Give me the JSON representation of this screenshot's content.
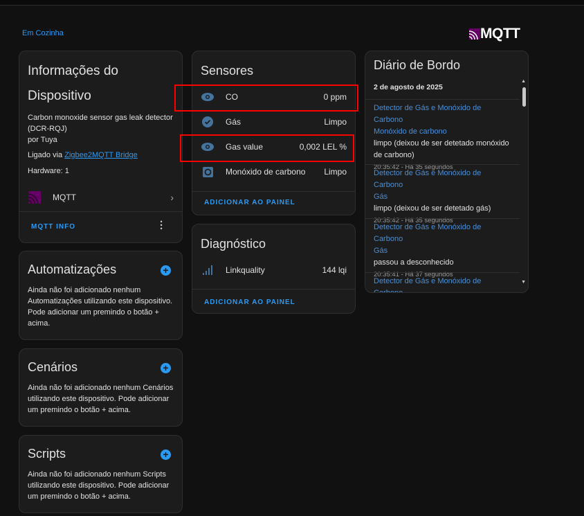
{
  "breadcrumb": "Em Cozinha",
  "logo": "MQTT",
  "device_info": {
    "title_line1": "Informações do",
    "title_line2": "Dispositivo",
    "model": "Carbon monoxide sensor gas leak detector",
    "model_id": "(DCR-RQJ)",
    "manufacturer": "por Tuya",
    "connected_prefix": "Ligado via ",
    "connected_link": "Zigbee2MQTT Bridge",
    "hardware": "Hardware: 1",
    "integration": "MQTT",
    "action": "MQTT INFO"
  },
  "automations": {
    "title": "Automatizações",
    "text": "Ainda não foi adicionado nenhum Automatizações utilizando este dispositivo. Pode adicionar um premindo o botão + acima."
  },
  "scenes": {
    "title": "Cenários",
    "text": "Ainda não foi adicionado nenhum Cenários utilizando este dispositivo. Pode adicionar um premindo o botão + acima."
  },
  "scripts": {
    "title": "Scripts",
    "text": "Ainda não foi adicionado nenhum Scripts utilizando este dispositivo. Pode adicionar um premindo o botão + acima."
  },
  "sensors": {
    "title": "Sensores",
    "items": [
      {
        "name": "CO",
        "value": "0 ppm",
        "icon": "eye-icon"
      },
      {
        "name": "Gás",
        "value": "Limpo",
        "icon": "check-circle-icon"
      },
      {
        "name": "Gas value",
        "value": "0,002 LEL %",
        "icon": "eye-icon"
      },
      {
        "name": "Monóxido de carbono",
        "value": "Limpo",
        "icon": "smoke-detector-icon"
      }
    ],
    "action": "ADICIONAR AO PAINEL"
  },
  "diagnostics": {
    "title": "Diagnóstico",
    "items": [
      {
        "name": "Linkquality",
        "value": "144 lqi",
        "icon": "signal-icon"
      }
    ],
    "action": "ADICIONAR AO PAINEL"
  },
  "logbook": {
    "title": "Diário de Bordo",
    "date": "2 de agosto de 2025",
    "entries": [
      {
        "entity": "Detector de Gás e Monóxido de Carbono",
        "sub": "Monóxido de carbono",
        "msg": "limpo (deixou de ser detetado monóxido de carbono)",
        "time": "20:35:42 - Há 35 segundos"
      },
      {
        "entity": "Detector de Gás e Monóxido de Carbono",
        "sub": "Gás",
        "msg": "limpo (deixou de ser detetado gás)",
        "time": "20:35:42 - Há 35 segundos"
      },
      {
        "entity": "Detector de Gás e Monóxido de Carbono",
        "sub": "Gás",
        "msg": "passou a desconhecido",
        "time": "20:35:41 - Há 37 segundos"
      },
      {
        "entity": "Detector de Gás e Monóxido de Carbono"
      }
    ]
  },
  "colors": {
    "accent": "#2b9af3",
    "highlight": "#ff0000",
    "icon": "#44739e",
    "mqtt": "#660066"
  }
}
